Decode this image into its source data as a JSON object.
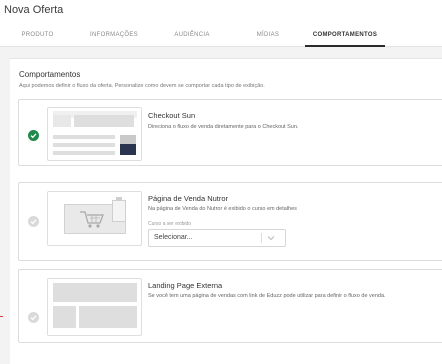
{
  "page": {
    "title": "Nova Oferta"
  },
  "tabs": [
    {
      "label": "PRODUTO",
      "active": false
    },
    {
      "label": "INFORMAÇÕES",
      "active": false
    },
    {
      "label": "AUDIÊNCIA",
      "active": false
    },
    {
      "label": "MÍDIAS",
      "active": false
    },
    {
      "label": "COMPORTAMENTOS",
      "active": true
    }
  ],
  "section": {
    "title": "Comportamentos",
    "description": "Aqui podemos definir o fluxo da oferta. Personalize como devem se comportar cada tipo de exibição."
  },
  "options": [
    {
      "title": "Checkout Sun",
      "description": "Direciona o fluxo de venda diretamente para o Checkout Sun.",
      "selected": true
    },
    {
      "title": "Página de Venda Nutror",
      "description": "Na página de Venda do Nutror é exibido o curso em detalhes",
      "selected": false,
      "field_label": "Curso a ser exibido",
      "select_value": "Selecionar..."
    },
    {
      "title": "Landing Page Externa",
      "description": "Se você tem uma página de vendas com link de Eduzz pode utilizar para definir o fluxo de venda.",
      "selected": false
    }
  ],
  "colors": {
    "selected": "#1f8a4c",
    "unselected": "#d9d9d9",
    "thumb_dark": "#2c3550"
  }
}
